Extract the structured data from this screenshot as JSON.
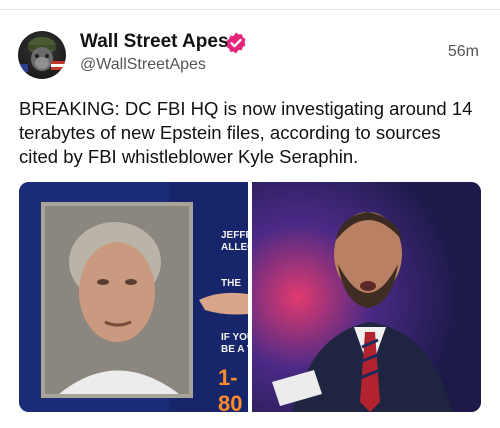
{
  "post": {
    "author_name": "Wall Street Apes",
    "handle": "@WallStreetApes",
    "timestamp": "56m",
    "text": "BREAKING: DC FBI HQ is now investigating around 14 terabytes of new Epstein files, according to sources cited by FBI whistleblower Kyle Seraphin."
  },
  "media": {
    "left_poster": {
      "line1": "JEFFREY",
      "line2": "ALLEGED",
      "line3": "THE",
      "line4": "IF YOU",
      "line5": "BE A VIC",
      "number": "1-80"
    }
  },
  "colors": {
    "verified_badge": "#e5247b",
    "text_primary": "#111111",
    "text_secondary": "#555555",
    "poster_blue": "#1c2d78",
    "poster_accent": "#ff8a2a"
  },
  "icons": {
    "verified": "verified-badge-icon",
    "avatar": "avatar"
  }
}
